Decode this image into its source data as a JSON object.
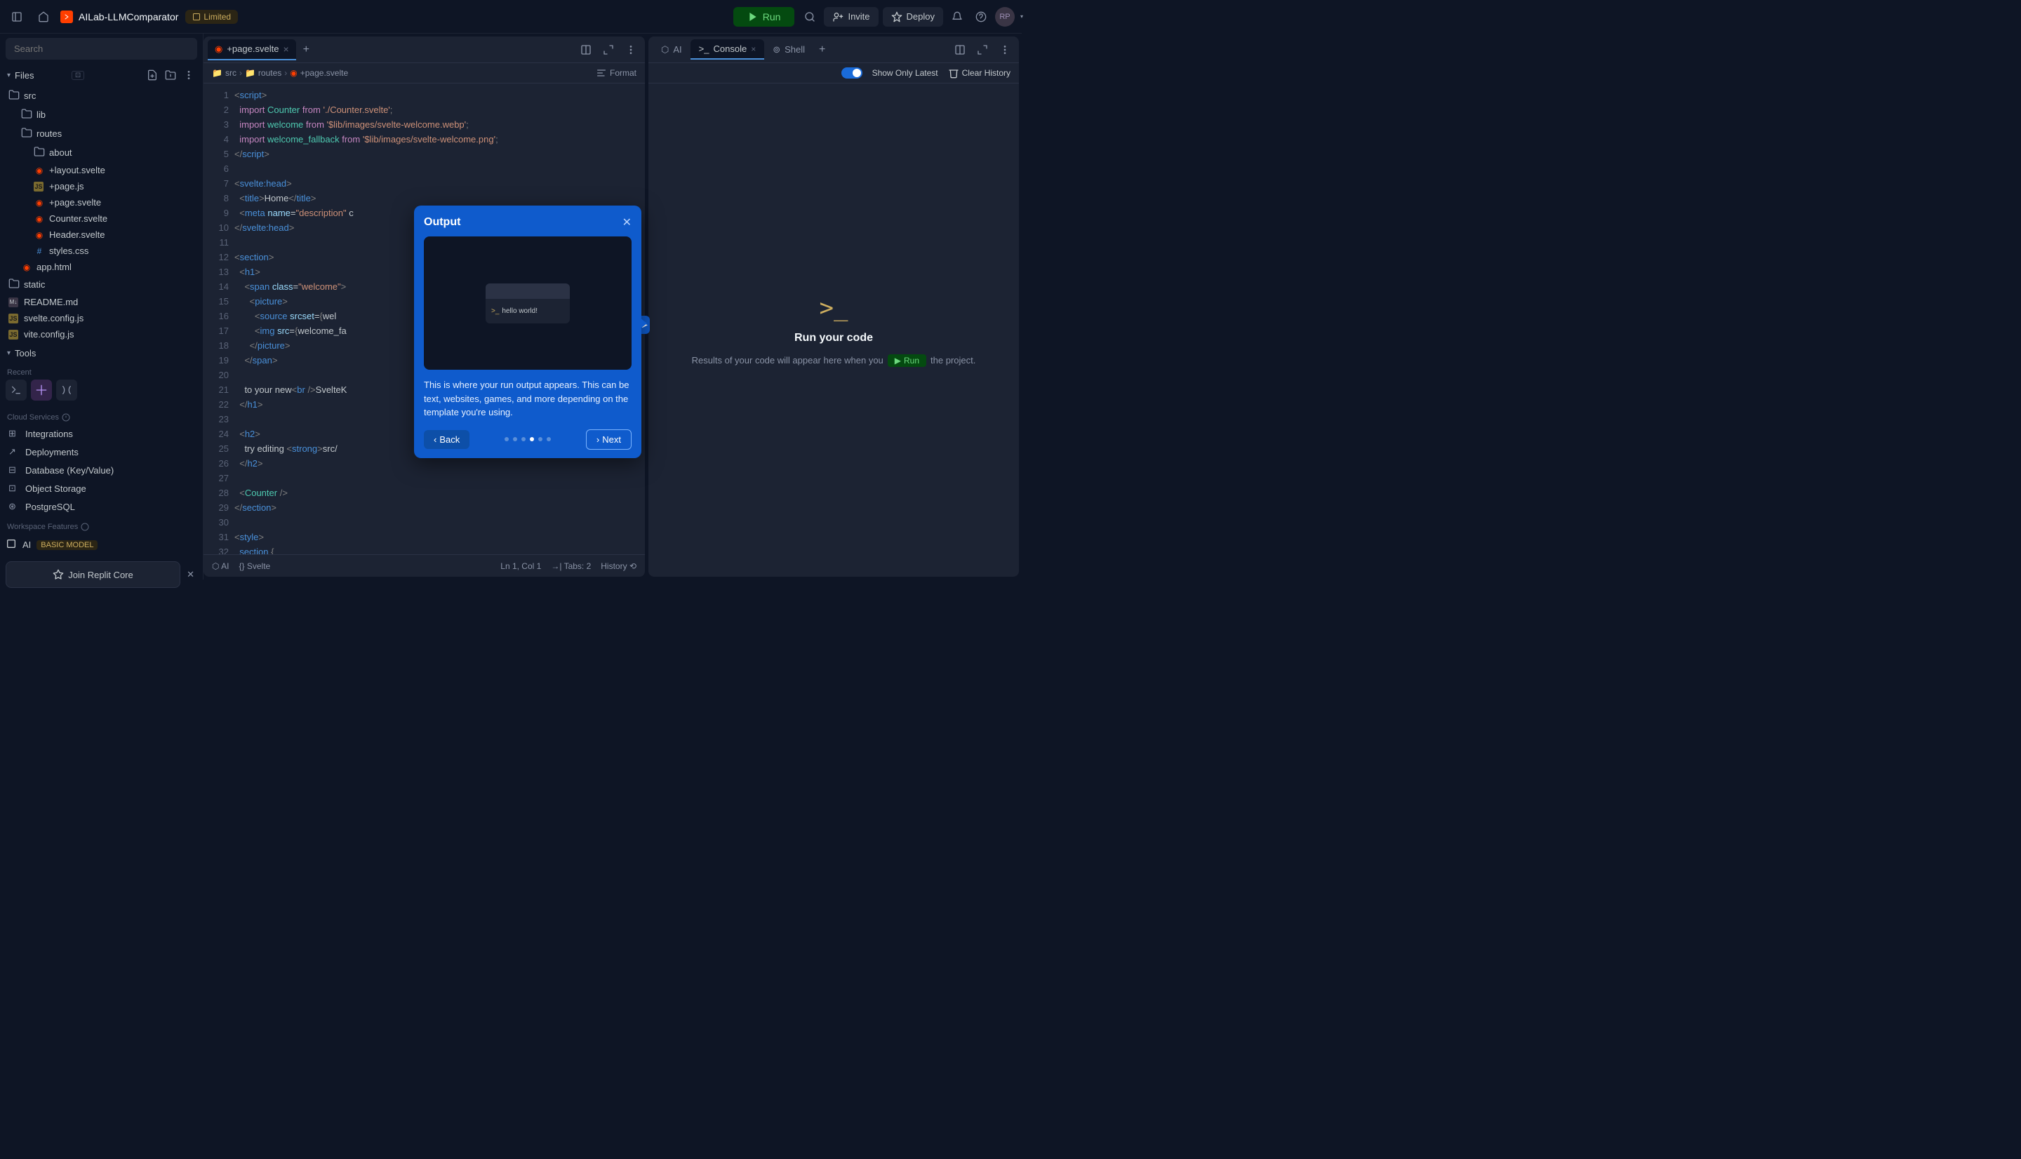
{
  "header": {
    "project_name": "AILab-LLMComparator",
    "limited_badge": "Limited",
    "run": "Run",
    "invite": "Invite",
    "deploy": "Deploy",
    "avatar": "RP"
  },
  "sidebar": {
    "search_placeholder": "Search",
    "files_label": "Files",
    "tree": [
      {
        "label": "src",
        "type": "folder",
        "indent": 0
      },
      {
        "label": "lib",
        "type": "folder",
        "indent": 1
      },
      {
        "label": "routes",
        "type": "folder",
        "indent": 1
      },
      {
        "label": "about",
        "type": "folder",
        "indent": 2
      },
      {
        "label": "+layout.svelte",
        "type": "svelte",
        "indent": 2
      },
      {
        "label": "+page.js",
        "type": "js",
        "indent": 2
      },
      {
        "label": "+page.svelte",
        "type": "svelte",
        "indent": 2
      },
      {
        "label": "Counter.svelte",
        "type": "svelte",
        "indent": 2
      },
      {
        "label": "Header.svelte",
        "type": "svelte",
        "indent": 2
      },
      {
        "label": "styles.css",
        "type": "css",
        "indent": 2
      },
      {
        "label": "app.html",
        "type": "svelte",
        "indent": 1
      },
      {
        "label": "static",
        "type": "folder",
        "indent": 0
      },
      {
        "label": "README.md",
        "type": "md",
        "indent": 0
      },
      {
        "label": "svelte.config.js",
        "type": "js",
        "indent": 0
      },
      {
        "label": "vite.config.js",
        "type": "js",
        "indent": 0
      }
    ],
    "tools_label": "Tools",
    "recent_label": "Recent",
    "cloud_label": "Cloud Services",
    "services": [
      "Integrations",
      "Deployments",
      "Database (Key/Value)",
      "Object Storage",
      "PostgreSQL"
    ],
    "workspace_label": "Workspace Features",
    "ai_label": "AI",
    "ai_badge": "BASIC MODEL",
    "join": "Join Replit Core"
  },
  "editor": {
    "tab_label": "+page.svelte",
    "breadcrumb": [
      "src",
      "routes",
      "+page.svelte"
    ],
    "format": "Format",
    "lines": [
      "1",
      "2",
      "3",
      "4",
      "5",
      "6",
      "7",
      "8",
      "9",
      "10",
      "11",
      "12",
      "13",
      "14",
      "15",
      "16",
      "17",
      "18",
      "19",
      "20",
      "21",
      "22",
      "23",
      "24",
      "25",
      "26",
      "27",
      "28",
      "29",
      "30",
      "31",
      "32"
    ],
    "status": {
      "ai": "AI",
      "lang": "Svelte",
      "pos": "Ln 1, Col 1",
      "tabs": "Tabs: 2",
      "history": "History"
    }
  },
  "right": {
    "tabs": {
      "ai": "AI",
      "console": "Console",
      "shell": "Shell"
    },
    "toolbar": {
      "show_only": "Show Only Latest",
      "clear": "Clear History"
    },
    "empty": {
      "title": "Run your code",
      "desc_pre": "Results of your code will appear here when you",
      "run": "Run",
      "desc_post": "the project."
    }
  },
  "tour": {
    "title": "Output",
    "hello": "hello world!",
    "desc": "This is where your run output appears. This can be text, websites, games, and more depending on the template you're using.",
    "back": "Back",
    "next": "Next",
    "step": 4,
    "total": 6
  }
}
